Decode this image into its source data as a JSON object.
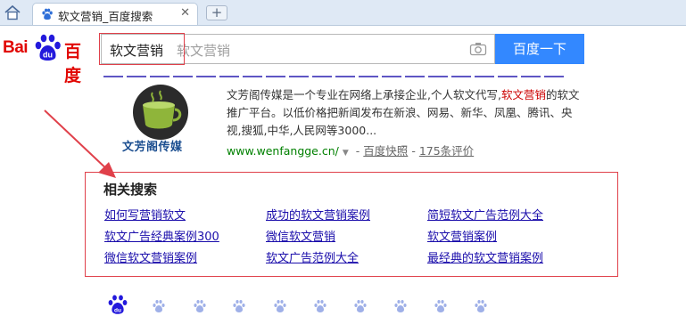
{
  "browser": {
    "tab_title": "软文营销_百度搜索",
    "new_tab_symbol": "+",
    "close_symbol": "✕"
  },
  "header": {
    "logo_latin": "Bai",
    "logo_du": "du",
    "logo_cn": "百度",
    "query": "软文营销",
    "ghost_query": "软文营销",
    "search_button": "百度一下"
  },
  "result": {
    "thumb_label": "文芳阁传媒",
    "abstract_before": "文芳阁传媒是一个专业在网络上承接企业,个人软文代写,",
    "abstract_highlight": "软文营销",
    "abstract_after": "的软文推广平台。以低价格把新闻发布在新浪、网易、新华、凤凰、腾讯、央视,搜狐,中华,人民网等3000...",
    "url": "www.wenfangge.cn/",
    "url_arrow": "▼",
    "dash": "-",
    "snapshot": "百度快照",
    "reviews": "175条评价"
  },
  "related": {
    "title": "相关搜索",
    "items": [
      "如何写营销软文",
      "成功的软文营销案例",
      "简短软文广告范例大全",
      "软文广告经典案例300",
      "微信软文营销",
      "软文营销案例",
      "微信软文营销案例",
      "软文广告范例大全",
      "最经典的软文营销案例"
    ]
  },
  "colors": {
    "brand_red": "#e10602",
    "brand_blue": "#2319dc",
    "search_button": "#3388ff",
    "annotation_red": "#e0404a",
    "link": "#1a0dab",
    "url_green": "#008000"
  },
  "icons": [
    "home-icon",
    "baidu-tab-icon",
    "camera-icon",
    "baidu-paw-icon",
    "pager-paw-icon"
  ]
}
